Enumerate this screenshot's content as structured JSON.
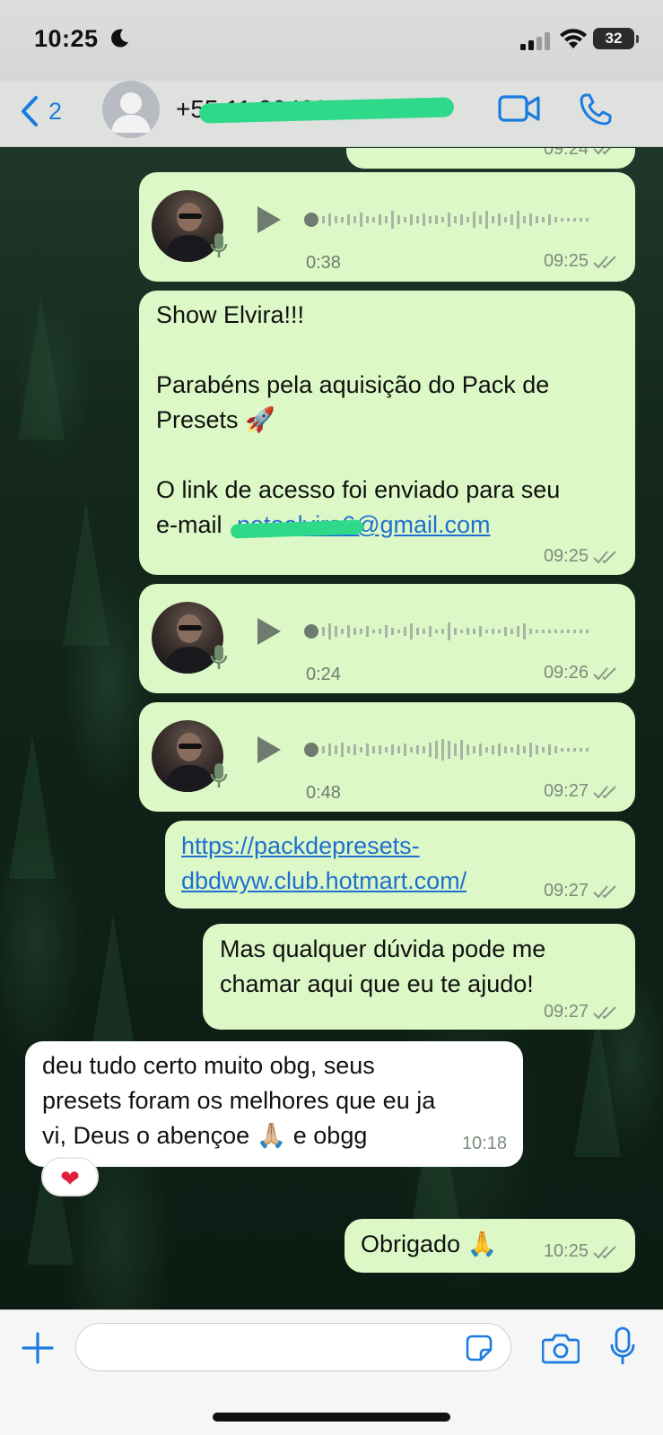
{
  "status_bar": {
    "time": "10:25",
    "battery": "32",
    "icons": [
      "moon-icon",
      "signal-icon",
      "wifi-icon",
      "battery-icon"
    ]
  },
  "header": {
    "back_count": "2",
    "contact_name": "+55 11 99498-1048",
    "icons": [
      "back-chevron-icon",
      "avatar-placeholder-icon",
      "video-call-icon",
      "phone-call-icon"
    ]
  },
  "messages": [
    {
      "type": "text",
      "direction": "out",
      "text": "",
      "time": "09:24"
    },
    {
      "type": "voice",
      "direction": "out",
      "duration": "0:38",
      "time": "09:25"
    },
    {
      "type": "text",
      "direction": "out",
      "lines": [
        "Show Elvira!!!",
        "",
        "Parabéns pela aquisição do Pack de",
        "Presets 🚀",
        "",
        "O link de acesso foi enviado para seu"
      ],
      "email_prefix": "e-mail",
      "email": "netoelvira6@gmail.com",
      "time": "09:25"
    },
    {
      "type": "voice",
      "direction": "out",
      "duration": "0:24",
      "time": "09:26"
    },
    {
      "type": "voice",
      "direction": "out",
      "duration": "0:48",
      "time": "09:27"
    },
    {
      "type": "link",
      "direction": "out",
      "lines": [
        "https://packdepresets-",
        "dbdwyw.club.hotmart.com/"
      ],
      "time": "09:27"
    },
    {
      "type": "text",
      "direction": "out",
      "lines": [
        "Mas qualquer dúvida pode me",
        "chamar aqui que eu te ajudo!"
      ],
      "time": "09:27"
    },
    {
      "type": "text",
      "direction": "in",
      "lines": [
        "deu tudo certo muito obg, seus",
        "presets foram os melhores que eu ja",
        "vi, Deus o abençoe 🙏🏼 e obgg"
      ],
      "time": "10:18",
      "reaction": "❤"
    },
    {
      "type": "text",
      "direction": "out",
      "lines": [
        "Obrigado 🙏"
      ],
      "time": "10:25"
    }
  ],
  "composer": {
    "placeholder": "",
    "icons": [
      "plus-icon",
      "sticker-icon",
      "camera-icon",
      "microphone-icon"
    ]
  },
  "colors": {
    "outgoing_bubble": "#dcf8c6",
    "incoming_bubble": "#ffffff",
    "link": "#1f6fd0",
    "accent": "#1b7ce0"
  }
}
